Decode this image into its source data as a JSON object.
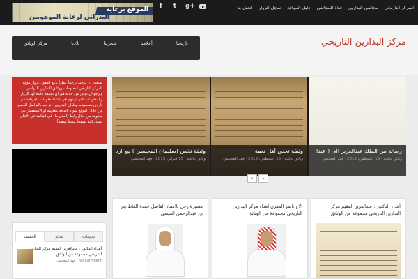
{
  "topnav": [
    "المركز التاريخي",
    "مجالس البدارين",
    "قناة المجالس",
    "دليل المواقع",
    "سجل الزوار",
    "اتصل بنا"
  ],
  "social": {
    "youtube_icon": "youtube-icon",
    "gplus": "g+",
    "twitter": "t",
    "facebook": "f"
  },
  "banner": {
    "line1": "الموقع برعاية",
    "line2": "البدراني لرعاية الموهوبين"
  },
  "site_title": "مركز البدارين التاريخي",
  "mainnav": [
    "تاريخنا",
    "أعلامنا",
    "شجرتنا",
    "بلادنا",
    "مركز الوثائق"
  ],
  "redbox": {
    "text": "يسعدنا ان نرحب ترحيباً عطراً بأبيع العقول بزوار موقع المركز التاريخي لمعلومات ووثائق البدارين الدواسر، ونرجو ان توفق من خلاله في ان نجمعه ناقده لهد الزوار والمعلومات التي تهمهم في بلاد المعلومات الجرافية في تاريخ وشخصيات ويلدان البدارين - نرحب بالتواصل الجميع من خلال الموقع سواء بإضافة معلومة او الاستفسار عن معلومة من خلال رابط (اتصل بنا) في القائمة في الأعلى - نتمنى لكم تصفحاً ممتعاً ومفيداً"
  },
  "tabs": {
    "active": "الحديث",
    "items": [
      "الحديث",
      "شائع",
      "تعليقات"
    ]
  },
  "recent": {
    "title": "أهداء الدكتور : عبدالعزيز المقيم مركز البدارين التاريخي مجموعة من الوثائق",
    "comments": "No Comment",
    "author": "فهد المحيسن"
  },
  "slides": [
    {
      "title": "وثيقة تخص (سليمان المحيسن ) بيع ارض",
      "meta": "وثائق عائلية  ·  15 فبراير، 2015  ·  فهد المحيسن"
    },
    {
      "title": "وثيقة تخص أهل نعمة",
      "meta": "وثائق عائلية  ·  15 أغسطس، 2015  ·  فهد المحيسن"
    },
    {
      "title": "رسالة من الملك عبدالعزيز الى ( عبدا",
      "meta": "وثائق عائلية  ·  15 أغسطس، 2015  ·  فهد المحيسن"
    }
  ],
  "arrows": {
    "prev": "‹",
    "next": "›"
  },
  "cards": [
    {
      "title": "مسيرة رجل للاستاذ الفاضل عمدة القاط بدر بن عبدالرحمن العيسى"
    },
    {
      "title": "الاخ ناصر المقرن أهداء مركز البدارين التاريخي مجموعة من الوثائق"
    },
    {
      "title": "أهداء الدكتور : عبدالعزيز المقيم مركز البدارين التاريخي مجموعة من الوثائق"
    }
  ]
}
